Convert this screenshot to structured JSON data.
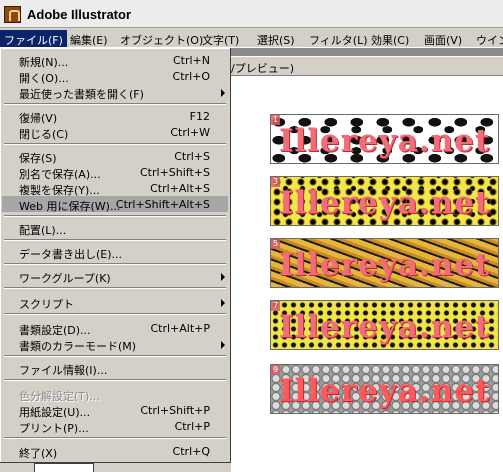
{
  "app": {
    "title": "Adobe Illustrator"
  },
  "menubar": {
    "items": [
      "ファイル(F)",
      "編集(E)",
      "オブジェクト(O)",
      "文字(T)",
      "選択(S)",
      "フィルタ(L)",
      "効果(C)",
      "画面(V)",
      "ウイン"
    ]
  },
  "document": {
    "title_fragment": "/プレビュー)",
    "banners": [
      {
        "num": "1",
        "text": "Illereya.net"
      },
      {
        "num": "3",
        "text": "Illereya.net"
      },
      {
        "num": "5",
        "text": "Illereya.net"
      },
      {
        "num": "7",
        "text": "Illereya.net"
      },
      {
        "num": "9",
        "text": "Illereya.net"
      }
    ]
  },
  "file_menu": {
    "items": [
      {
        "label": "新規(N)...",
        "shortcut": "Ctrl+N"
      },
      {
        "label": "開く(O)...",
        "shortcut": "Ctrl+O"
      },
      {
        "label": "最近使った書類を開く(F)"
      },
      {
        "label": "復帰(V)",
        "shortcut": "F12"
      },
      {
        "label": "閉じる(C)",
        "shortcut": "Ctrl+W"
      },
      {
        "label": "保存(S)",
        "shortcut": "Ctrl+S"
      },
      {
        "label": "別名で保存(A)...",
        "shortcut": "Ctrl+Shift+S"
      },
      {
        "label": "複製を保存(Y)...",
        "shortcut": "Ctrl+Alt+S"
      },
      {
        "label": "Web 用に保存(W)...",
        "shortcut": "Ctrl+Shift+Alt+S"
      },
      {
        "label": "配置(L)..."
      },
      {
        "label": "データ書き出し(E)..."
      },
      {
        "label": "ワークグループ(K)"
      },
      {
        "label": "スクリプト"
      },
      {
        "label": "書類設定(D)...",
        "shortcut": "Ctrl+Alt+P"
      },
      {
        "label": "書類のカラーモード(M)"
      },
      {
        "label": "ファイル情報(I)..."
      },
      {
        "label": "色分解設定(T)..."
      },
      {
        "label": "用紙設定(U)...",
        "shortcut": "Ctrl+Shift+P"
      },
      {
        "label": "プリント(P)...",
        "shortcut": "Ctrl+P"
      },
      {
        "label": "終了(X)",
        "shortcut": "Ctrl+Q"
      }
    ]
  },
  "colors": {
    "highlight": "#a6a6a6",
    "menu_active": "#0a246a",
    "banner_text": "#f06e78"
  }
}
